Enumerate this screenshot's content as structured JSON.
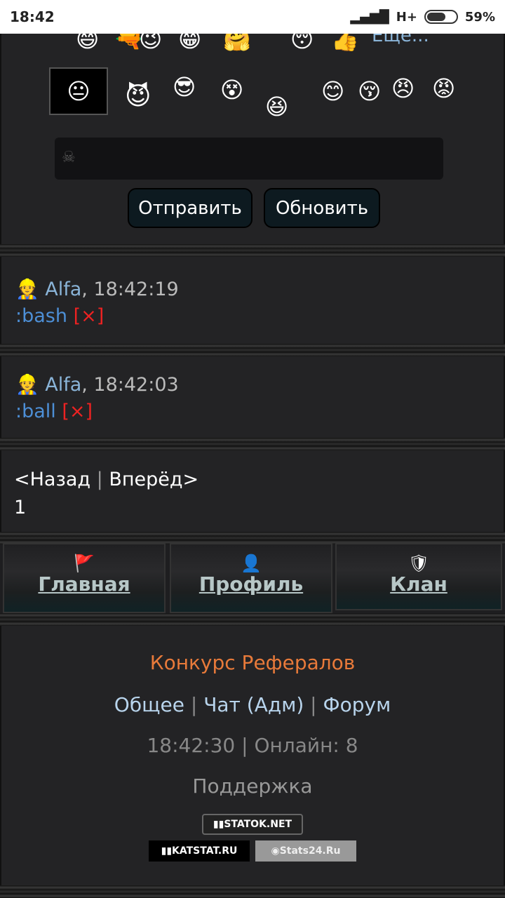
{
  "statusbar": {
    "time": "18:42",
    "network": "H+",
    "battery": "59%"
  },
  "smileys": {
    "more_label": "Еще..."
  },
  "composer": {
    "send_label": "Отправить",
    "refresh_label": "Обновить"
  },
  "messages": [
    {
      "author": "Alfa",
      "time": "18:42:19",
      "text": ":bash",
      "delete": "[×]"
    },
    {
      "author": "Alfa",
      "time": "18:42:03",
      "text": ":ball",
      "delete": "[×]"
    }
  ],
  "pager": {
    "back": "<Назад",
    "forward": "Вперёд>",
    "page": "1"
  },
  "nav": [
    {
      "label": "Главная",
      "icon": "home-flag-icon"
    },
    {
      "label": "Профиль",
      "icon": "person-icon"
    },
    {
      "label": "Клан",
      "icon": "shield-icon"
    }
  ],
  "footer": {
    "contest": "Конкурс Рефералов",
    "links": [
      "Общее",
      "Чат",
      "(Адм)",
      "Форум"
    ],
    "time": "18:42:30",
    "online_label": "Онлайн: 8",
    "support": "Поддержка",
    "counters": [
      "STATOK.NET",
      "KATSTAT.RU",
      "Stats24.Ru"
    ]
  },
  "colors": {
    "accent_blue": "#4d8fd6",
    "author_blue": "#8ab4d8",
    "contest_orange": "#e87a3a",
    "delete_red": "#e22"
  }
}
